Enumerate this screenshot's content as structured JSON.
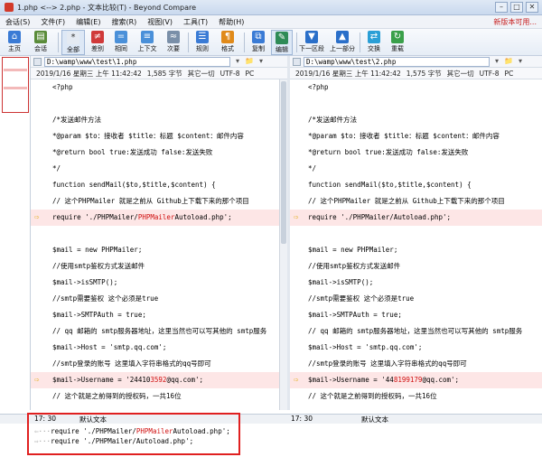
{
  "titlebar": {
    "title": "1.php <--> 2.php - 文本比较(T) - Beyond Compare",
    "min": "–",
    "max": "□",
    "close": "✕"
  },
  "menu": {
    "items": [
      "会话(S)",
      "文件(F)",
      "编辑(E)",
      "搜索(R)",
      "视图(V)",
      "工具(T)",
      "帮助(H)"
    ],
    "help": "新版本可用..."
  },
  "toolbar": {
    "buttons": [
      "主页",
      "会话",
      "全部",
      "差别",
      "相同",
      "上下文",
      "次要",
      "规则",
      "格式",
      "复制",
      "编辑",
      "下一区段",
      "上一部分",
      "交换",
      "重载"
    ],
    "colors": [
      "#3a7bd5",
      "#5a8c3a",
      "#e4eaf2",
      "#d03a3a",
      "#4a90d9",
      "#4a90d9",
      "#7a8fa8",
      "#3a7bd5",
      "#e08a1a",
      "#3a7bd5",
      "#2e8b57",
      "#2a6fc9",
      "#2a6fc9",
      "#2a9fd6",
      "#3aa04a"
    ]
  },
  "left": {
    "path": "D:\\wamp\\www\\test\\1.php",
    "info": [
      "2019/1/16 星期三 上午 11:42:42",
      "1,585 字节",
      "其它一切",
      "UTF-8",
      "PC"
    ],
    "lines": [
      {
        "t": "<?php",
        "d": false
      },
      {
        "t": "",
        "d": false
      },
      {
        "t": "/*发送邮件方法",
        "d": false
      },
      {
        "t": " *@param $to：接收者 $title：标题 $content：邮件内容",
        "d": false
      },
      {
        "t": " *@return bool true:发送成功 false:发送失败",
        "d": false
      },
      {
        "t": " */",
        "d": false
      },
      {
        "t": "function sendMail($to,$title,$content) {",
        "d": false
      },
      {
        "t": "    // 这个PHPMailer 就是之前从 Github上下载下来的那个项目",
        "d": false
      },
      {
        "a": "    require './PHPMailer/",
        "h": "PHPMailer",
        "b": "Autoload.php';",
        "d": true
      },
      {
        "t": "",
        "d": false
      },
      {
        "t": "    $mail = new PHPMailer;",
        "d": false
      },
      {
        "t": "    //使用smtp鉴权方式发送邮件",
        "d": false
      },
      {
        "t": "    $mail->isSMTP();",
        "d": false
      },
      {
        "t": "    //smtp需要鉴权 这个必须是true",
        "d": false
      },
      {
        "t": "    $mail->SMTPAuth = true;",
        "d": false
      },
      {
        "t": "    // qq 邮箱的 smtp服务器地址，这里当然也可以写其他的 smtp服务",
        "d": false
      },
      {
        "t": "    $mail->Host = 'smtp.qq.com';",
        "d": false
      },
      {
        "t": "    //smtp登录的账号 这里填入字符串格式的qq号即可",
        "d": false
      },
      {
        "a": "    $mail->Username = '24410",
        "h": "3592",
        "b": "@qq.com';",
        "d": true
      },
      {
        "t": "    // 这个就是之前得到的授权码，一共16位",
        "d": false
      }
    ]
  },
  "right": {
    "path": "D:\\wamp\\www\\test\\2.php",
    "info": [
      "2019/1/16 星期三 上午 11:42:42",
      "1,575 字节",
      "其它一切",
      "UTF-8",
      "PC"
    ],
    "lines": [
      {
        "t": "<?php",
        "d": false
      },
      {
        "t": "",
        "d": false
      },
      {
        "t": "/*发送邮件方法",
        "d": false
      },
      {
        "t": " *@param $to：接收者 $title：标题 $content：邮件内容",
        "d": false
      },
      {
        "t": " *@return bool true:发送成功 false:发送失败",
        "d": false
      },
      {
        "t": " */",
        "d": false
      },
      {
        "t": "function sendMail($to,$title,$content) {",
        "d": false
      },
      {
        "t": "    // 这个PHPMailer 就是之前从 Github上下载下来的那个项目",
        "d": false
      },
      {
        "a": "    require './PHPMailer/Autoload.php';",
        "h": "",
        "b": "",
        "d": true
      },
      {
        "t": "",
        "d": false
      },
      {
        "t": "    $mail = new PHPMailer;",
        "d": false
      },
      {
        "t": "    //使用smtp鉴权方式发送邮件",
        "d": false
      },
      {
        "t": "    $mail->isSMTP();",
        "d": false
      },
      {
        "t": "    //smtp需要鉴权 这个必须是true",
        "d": false
      },
      {
        "t": "    $mail->SMTPAuth = true;",
        "d": false
      },
      {
        "t": "    // qq 邮箱的 smtp服务器地址，这里当然也可以写其他的 smtp服务",
        "d": false
      },
      {
        "t": "    $mail->Host = 'smtp.qq.com';",
        "d": false
      },
      {
        "t": "    //smtp登录的账号 这里填入字符串格式的qq号即可",
        "d": false
      },
      {
        "a": "    $mail->Username = '44",
        "h": "8199179",
        "b": "@qq.com';",
        "d": true
      },
      {
        "t": "    // 这个就是之前得到的授权码，一共16位",
        "d": false
      }
    ]
  },
  "status": {
    "left_pos": "17: 30",
    "left_enc": "默认文本",
    "right_pos": "17: 30",
    "right_enc": "默认文本"
  },
  "bottom": {
    "l1_a": "require './PHPMailer/",
    "l1_h": "PHPMailer",
    "l1_b": "Autoload.php';",
    "l2": "require './PHPMailer/Autoload.php';"
  }
}
